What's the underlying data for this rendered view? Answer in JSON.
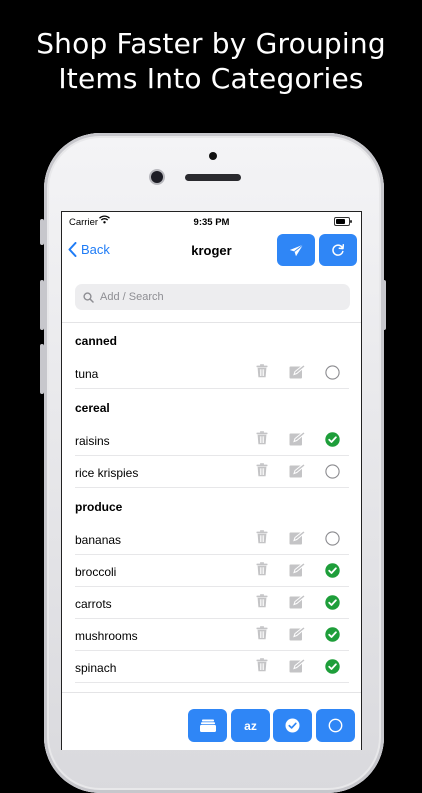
{
  "marketing": {
    "headline_line1": "Shop Faster by Grouping",
    "headline_line2": "Items Into Categories"
  },
  "status_bar": {
    "carrier": "Carrier",
    "time": "9:35 PM"
  },
  "nav": {
    "back_label": "Back",
    "title": "kroger"
  },
  "search": {
    "placeholder": "Add / Search",
    "value": ""
  },
  "categories": [
    {
      "name": "canned",
      "items": [
        {
          "name": "tuna",
          "checked": false
        }
      ]
    },
    {
      "name": "cereal",
      "items": [
        {
          "name": "raisins",
          "checked": true
        },
        {
          "name": "rice krispies",
          "checked": false
        }
      ]
    },
    {
      "name": "produce",
      "items": [
        {
          "name": "bananas",
          "checked": false
        },
        {
          "name": "broccoli",
          "checked": true
        },
        {
          "name": "carrots",
          "checked": true
        },
        {
          "name": "mushrooms",
          "checked": true
        },
        {
          "name": "spinach",
          "checked": true
        }
      ]
    }
  ],
  "toolbar": {
    "sort_label": "az"
  },
  "icons": {
    "send": "paper-plane-icon",
    "refresh": "refresh-icon",
    "trash": "trash-icon",
    "edit": "edit-icon",
    "checked": "check-circle-icon",
    "unchecked": "empty-circle-icon",
    "categories": "folder-stack-icon",
    "check_all": "check-circle-icon",
    "uncheck_all": "empty-circle-icon"
  },
  "colors": {
    "accent": "#2f86f6",
    "checked": "#1e9e3a",
    "icon_gray": "#c4c4c6"
  }
}
